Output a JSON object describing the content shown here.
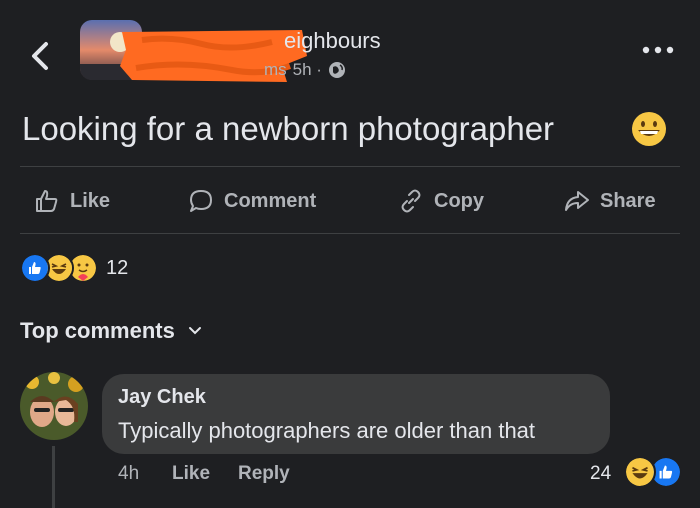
{
  "header": {
    "group_name": "eighbours",
    "meta_prefix": "ms",
    "time": "5h ·",
    "redaction_color": "#ff6a21"
  },
  "post": {
    "text": "Looking for a newborn photographer",
    "emoji": "grinning-face"
  },
  "actions": {
    "like": "Like",
    "comment": "Comment",
    "copy": "Copy",
    "share": "Share"
  },
  "reactions": {
    "count": "12",
    "types": [
      "like",
      "haha",
      "care"
    ]
  },
  "comments_section": {
    "title": "Top comments"
  },
  "comment": {
    "author": "Jay Chek",
    "text": "Typically photographers are older than that",
    "time": "4h",
    "like_label": "Like",
    "reply_label": "Reply",
    "reaction_count": "24",
    "reaction_types": [
      "haha",
      "like"
    ]
  },
  "colors": {
    "background": "#1e1f22",
    "bubble": "#3a3b3c",
    "secondary_text": "#b0b3b8",
    "like_blue": "#1877f2",
    "emoji_yellow": "#f7c744"
  }
}
